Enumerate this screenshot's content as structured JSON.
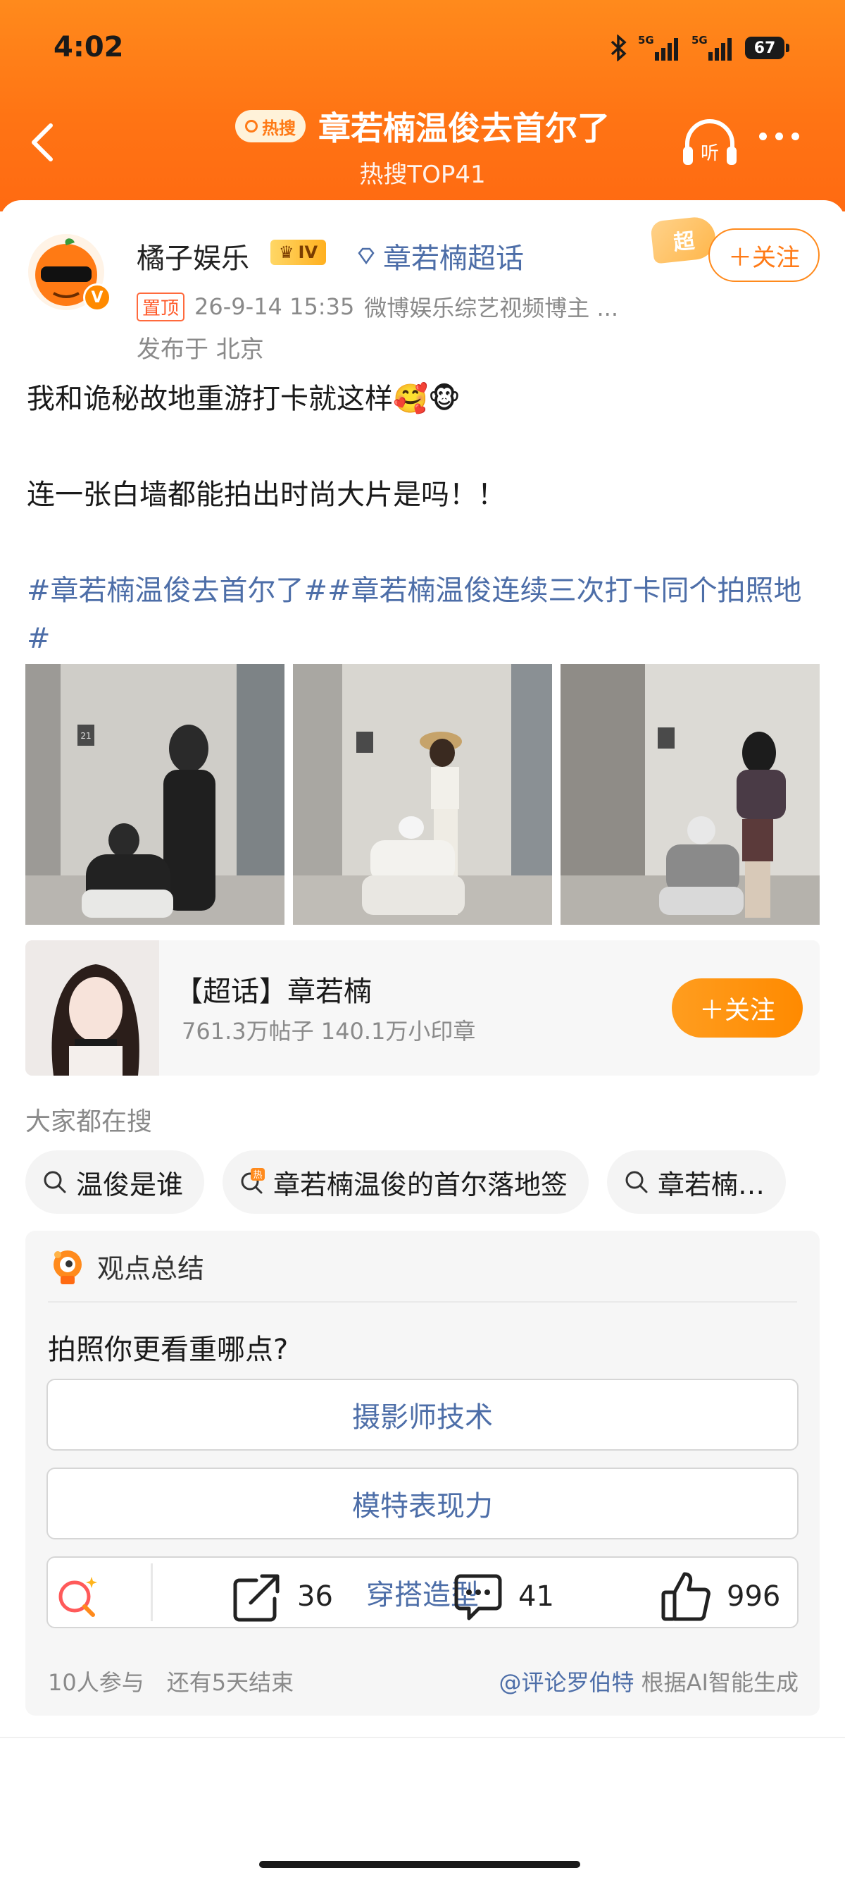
{
  "status_bar": {
    "time": "4:02",
    "net1": "5G",
    "net2": "5G",
    "battery": "67"
  },
  "nav": {
    "hot_badge": "热搜",
    "title": "章若楠温俊去首尔了",
    "subtitle": "热搜TOP41",
    "listen_label": "听"
  },
  "post": {
    "author": "橘子娱乐",
    "level": "IV",
    "v_badge": "V",
    "supertopic_link": "章若楠超话",
    "super_tag": "超",
    "follow_label": "＋关注",
    "pinned": "置顶",
    "datetime": "26-9-14 15:35",
    "source": "微博娱乐综艺视频博主 ...",
    "location": "发布于 北京",
    "line1": "我和诡秘故地重游打卡就这样🥰🐵",
    "line2": "连一张白墙都能拍出时尚大片是吗！！",
    "hashtag1": "#章若楠温俊去首尔了#",
    "hashtag2": "#章若楠温俊连续三次打卡同个拍照地#",
    "photo_number": "21"
  },
  "super_card": {
    "title": "【超话】章若楠",
    "stats": "761.3万帖子 140.1万小印章",
    "follow_label": "＋关注"
  },
  "search": {
    "heading": "大家都在搜",
    "chips": [
      {
        "label": "温俊是谁",
        "hot": false
      },
      {
        "label": "章若楠温俊的首尔落地签",
        "hot": true
      },
      {
        "label": "章若楠…",
        "hot": false
      }
    ],
    "hot_mark": "热"
  },
  "opinion": {
    "heading": "观点总结",
    "question": "拍照你更看重哪点?",
    "options": [
      "摄影师技术",
      "模特表现力",
      "穿搭造型"
    ],
    "participants": "10人参与",
    "remaining": "还有5天结束",
    "ai_author": "@评论罗伯特",
    "ai_note": " 根据AI智能生成"
  },
  "toolbar": {
    "share_count": "36",
    "comment_count": "41",
    "like_count": "996"
  },
  "colors": {
    "brand_orange": "#ff7414",
    "link_blue": "#4d6ea8",
    "muted": "#8a8a8a"
  }
}
